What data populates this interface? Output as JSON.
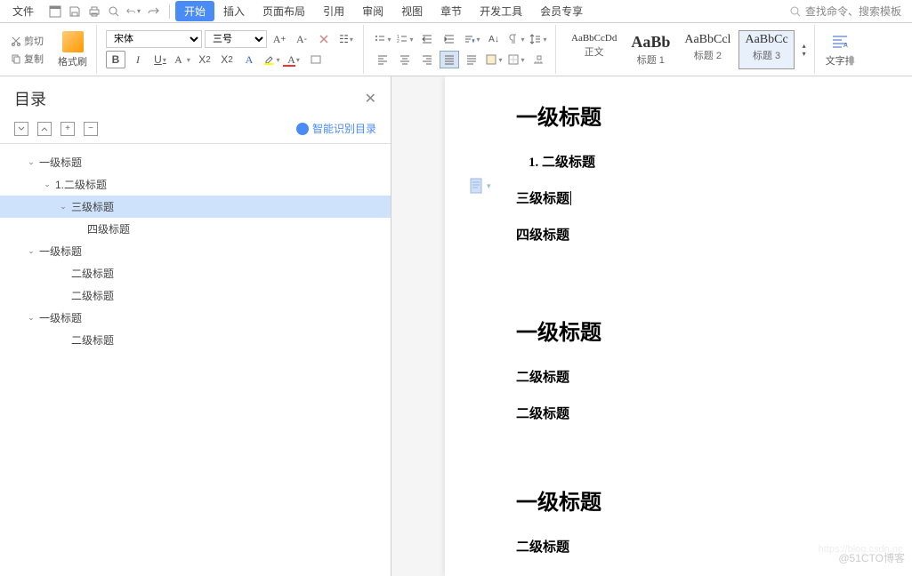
{
  "menu": {
    "file": "文件",
    "items": [
      "开始",
      "插入",
      "页面布局",
      "引用",
      "审阅",
      "视图",
      "章节",
      "开发工具",
      "会员专享"
    ],
    "active_index": 0,
    "search_placeholder": "查找命令、搜索模板"
  },
  "clipboard": {
    "cut": "剪切",
    "copy": "复制",
    "format_brush": "格式刷"
  },
  "font": {
    "name": "宋体",
    "size": "三号"
  },
  "styles": [
    {
      "preview": "AaBbCcDd",
      "name": "正文"
    },
    {
      "preview": "AaBb",
      "name": "标题 1"
    },
    {
      "preview": "AaBbCcl",
      "name": "标题 2"
    },
    {
      "preview": "AaBbCc",
      "name": "标题 3"
    }
  ],
  "selected_style_index": 3,
  "text_arrange": "文字排",
  "outline": {
    "title": "目录",
    "smart": "智能识别目录",
    "tree": [
      {
        "label": "一级标题",
        "level": 0,
        "caret": true
      },
      {
        "label": "1.二级标题",
        "level": 1,
        "caret": true
      },
      {
        "label": "三级标题",
        "level": 2,
        "caret": true,
        "selected": true
      },
      {
        "label": "四级标题",
        "level": 3,
        "caret": false
      },
      {
        "label": "一级标题",
        "level": 0,
        "caret": true
      },
      {
        "label": "二级标题",
        "level": 1,
        "caret": false,
        "indent_extra": true
      },
      {
        "label": "二级标题",
        "level": 1,
        "caret": false,
        "indent_extra": true
      },
      {
        "label": "一级标题",
        "level": 0,
        "caret": true
      },
      {
        "label": "二级标题",
        "level": 1,
        "caret": false,
        "indent_extra": true
      }
    ]
  },
  "document": {
    "blocks": [
      {
        "text": "一级标题",
        "class": "h1"
      },
      {
        "text": "1. 二级标题",
        "class": "h2"
      },
      {
        "text": "三级标题",
        "class": "h3",
        "cursor": true
      },
      {
        "text": "四级标题",
        "class": "h4"
      },
      {
        "text": "一级标题",
        "class": "h1",
        "spacer_before": 60
      },
      {
        "text": "二级标题",
        "class": "h3"
      },
      {
        "text": "二级标题",
        "class": "h3"
      },
      {
        "text": "一级标题",
        "class": "h1",
        "spacer_before": 50
      },
      {
        "text": "二级标题",
        "class": "h3"
      }
    ]
  },
  "watermark": "@51CTO博客",
  "watermark2": "https://blog.csdn.ne"
}
